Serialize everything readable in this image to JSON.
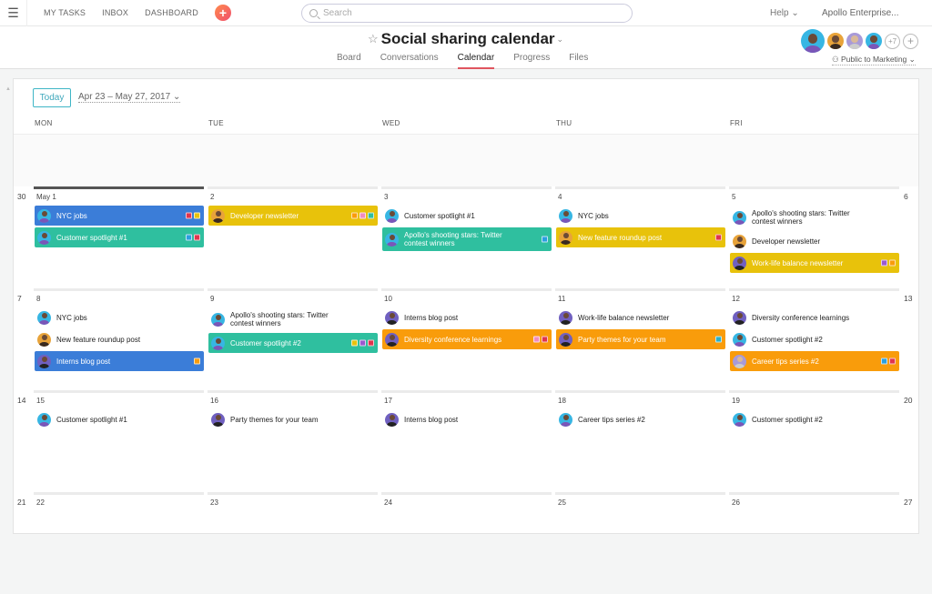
{
  "topbar": {
    "menu_icon": "hamburger-icon",
    "nav": [
      "MY TASKS",
      "INBOX",
      "DASHBOARD"
    ],
    "add_icon": "plus-icon",
    "search_placeholder": "Search",
    "help": "Help ⌄",
    "org": "Apollo Enterprise..."
  },
  "project": {
    "title": "Social sharing calendar",
    "tabs": [
      "Board",
      "Conversations",
      "Calendar",
      "Progress",
      "Files"
    ],
    "active_tab": "Calendar",
    "member_overflow": "+7",
    "visibility": "Public to Marketing ⌄"
  },
  "toolbar": {
    "today": "Today",
    "range": "Apr 23 – May 27, 2017 ⌄"
  },
  "weekdays": [
    "MON",
    "TUE",
    "WED",
    "THU",
    "FRI"
  ],
  "colors": {
    "blue": "#3b7dd8",
    "teal": "#2fbf9f",
    "yellow": "#e8c20b",
    "orange": "#f99c0b",
    "accent": "#e0555f"
  },
  "weeks": [
    {
      "sun": "30",
      "sat": "6",
      "days": [
        {
          "label": "May 1",
          "today": true,
          "events": [
            {
              "title": "NYC jobs",
              "style": "blue",
              "av": "blue",
              "tags": [
                "#e0344e",
                "#e8c20b"
              ]
            },
            {
              "title": "Customer spotlight #1",
              "style": "teal",
              "av": "blue",
              "tags": [
                "#2a9fe0",
                "#e0344e"
              ]
            }
          ]
        },
        {
          "label": "2",
          "events": [
            {
              "title": "Developer newsletter",
              "style": "yellow",
              "av": "gold",
              "tags": [
                "#f99c0b",
                "#f08cc0",
                "#2fbf9f"
              ]
            }
          ]
        },
        {
          "label": "3",
          "events": [
            {
              "title": "Customer spotlight #1",
              "style": "plain",
              "av": "blue"
            },
            {
              "title": "Apollo's shooting stars: Twitter contest winners",
              "style": "teal",
              "av": "blue",
              "tall": true,
              "tags": [
                "#2a9fe0"
              ]
            }
          ]
        },
        {
          "label": "4",
          "events": [
            {
              "title": "NYC jobs",
              "style": "plain",
              "av": "blue"
            },
            {
              "title": "New feature roundup post",
              "style": "yellow",
              "av": "gold",
              "tags": [
                "#e0344e"
              ]
            }
          ]
        },
        {
          "label": "5",
          "events": [
            {
              "title": "Apollo's shooting stars: Twitter contest winners",
              "style": "plain",
              "av": "blue",
              "tall": true
            },
            {
              "title": "Developer newsletter",
              "style": "plain",
              "av": "gold"
            },
            {
              "title": "Work-life balance newsletter",
              "style": "yellow",
              "av": "purple",
              "tags": [
                "#9b59d0",
                "#f99c0b"
              ]
            }
          ]
        }
      ]
    },
    {
      "sun": "7",
      "sat": "13",
      "days": [
        {
          "label": "8",
          "events": [
            {
              "title": "NYC jobs",
              "style": "plain",
              "av": "blue"
            },
            {
              "title": "New feature roundup post",
              "style": "plain",
              "av": "gold"
            },
            {
              "title": "Interns blog post",
              "style": "blue",
              "av": "purple",
              "tags": [
                "#f99c0b"
              ]
            }
          ]
        },
        {
          "label": "9",
          "events": [
            {
              "title": "Apollo's shooting stars: Twitter contest winners",
              "style": "plain",
              "av": "blue",
              "tall": true
            },
            {
              "title": "Customer spotlight #2",
              "style": "teal",
              "av": "blue",
              "tags": [
                "#e8c20b",
                "#9b59d0",
                "#e0344e"
              ]
            }
          ]
        },
        {
          "label": "10",
          "events": [
            {
              "title": "Interns blog post",
              "style": "plain",
              "av": "purple"
            },
            {
              "title": "Diversity conference learnings",
              "style": "orange",
              "av": "purple",
              "tags": [
                "#f08cc0",
                "#e0344e"
              ]
            }
          ]
        },
        {
          "label": "11",
          "events": [
            {
              "title": "Work-life balance newsletter",
              "style": "plain",
              "av": "purple"
            },
            {
              "title": "Party themes for your team",
              "style": "orange",
              "av": "purple",
              "tags": [
                "#2ab0c8"
              ]
            }
          ]
        },
        {
          "label": "12",
          "events": [
            {
              "title": "Diversity conference learnings",
              "style": "plain",
              "av": "purple"
            },
            {
              "title": "Customer spotlight #2",
              "style": "plain",
              "av": "blue"
            },
            {
              "title": "Career tips series #2",
              "style": "orange",
              "av": "lav",
              "tags": [
                "#2a9fe0",
                "#e0344e"
              ]
            }
          ]
        }
      ]
    },
    {
      "sun": "14",
      "sat": "20",
      "days": [
        {
          "label": "15",
          "events": [
            {
              "title": "Customer spotlight #1",
              "style": "plain",
              "av": "blue"
            }
          ]
        },
        {
          "label": "16",
          "events": [
            {
              "title": "Party themes for your team",
              "style": "plain",
              "av": "purple"
            }
          ]
        },
        {
          "label": "17",
          "events": [
            {
              "title": "Interns blog post",
              "style": "plain",
              "av": "purple"
            }
          ]
        },
        {
          "label": "18",
          "events": [
            {
              "title": "Career tips series #2",
              "style": "plain",
              "av": "blue"
            }
          ]
        },
        {
          "label": "19",
          "events": [
            {
              "title": "Customer spotlight #2",
              "style": "plain",
              "av": "blue"
            }
          ]
        }
      ]
    },
    {
      "sun": "21",
      "sat": "27",
      "days": [
        {
          "label": "22",
          "events": []
        },
        {
          "label": "23",
          "events": []
        },
        {
          "label": "24",
          "events": []
        },
        {
          "label": "25",
          "events": []
        },
        {
          "label": "26",
          "events": []
        }
      ]
    }
  ]
}
